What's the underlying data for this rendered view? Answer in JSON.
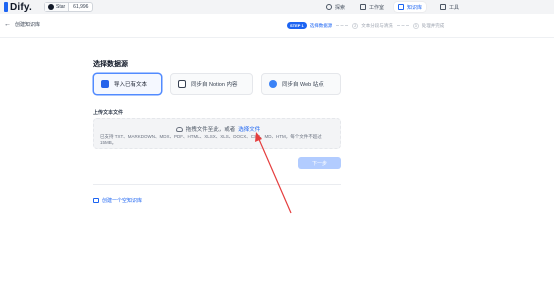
{
  "topbar": {
    "brand": "Dify.",
    "github": {
      "label": "Star",
      "count": "61,996"
    },
    "nav": [
      {
        "label": "探索",
        "icon": "compass-icon"
      },
      {
        "label": "工作室",
        "icon": "grid-icon"
      },
      {
        "label": "知识库",
        "icon": "book-icon",
        "active": true
      },
      {
        "label": "工具",
        "icon": "tools-icon"
      }
    ]
  },
  "header": {
    "back_label": "创建知识库",
    "steps": [
      {
        "pill": "STEP 1",
        "label": "选择数据源",
        "state": "active"
      },
      {
        "num": "2",
        "label": "文本分段与清洗",
        "state": "pending"
      },
      {
        "num": "3",
        "label": "处理并完成",
        "state": "pending"
      }
    ]
  },
  "main": {
    "section_title": "选择数据源",
    "sources": [
      {
        "label": "导入已有文本",
        "icon": "file-icon",
        "selected": true
      },
      {
        "label": "同步自 Notion 内容",
        "icon": "notion-icon",
        "selected": false
      },
      {
        "label": "同步自 Web 站点",
        "icon": "web-icon",
        "selected": false
      }
    ],
    "upload_label": "上传文本文件",
    "dropzone": {
      "text": "拖拽文件至此，或者",
      "link": "选择文件",
      "hint": "已支持 TXT、MARKDOWN、MDX、PDF、HTML、XLSX、XLS、DOCX、CSV、MD、HTM，每个文件不超过 15MB。"
    },
    "next_button": "下一步",
    "empty_link": "创建一个空知识库"
  },
  "annotation": {
    "color": "#e53e3e"
  }
}
